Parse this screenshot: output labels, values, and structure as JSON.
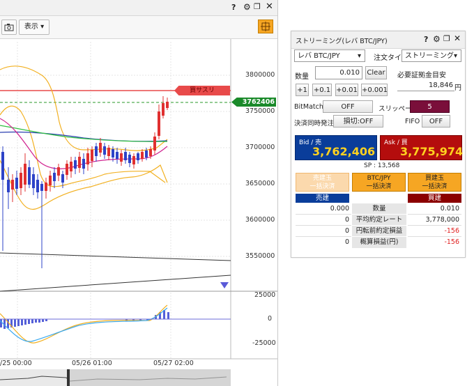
{
  "chart_window": {
    "toolbar": {
      "display_label": "表示 ▾"
    },
    "price_axis": [
      "3800000",
      "3750000",
      "3700000",
      "3650000",
      "3600000",
      "3550000"
    ],
    "current_price_tag": "3762406",
    "order_line_label": "買サスリ",
    "oscillator_axis": [
      "25000",
      "0",
      "-25000"
    ],
    "time_axis": [
      "/25 00:00",
      "05/26 01:00",
      "05/27 02:00"
    ]
  },
  "panel": {
    "title": "ストリーミング(レバ BTC/JPY)",
    "symbol": "レバ BTC/JPY",
    "order_type_label": "注文タイプ",
    "order_type_value": "ストリーミング",
    "quantity_label": "数量",
    "quantity_value": "0.010",
    "clear_label": "Clear",
    "margin_label": "必要証拠金目安",
    "margin_value": "18,846",
    "margin_unit": "円",
    "increments": [
      "+1",
      "+0.1",
      "+0.01",
      "+0.001"
    ],
    "bitmatch_label": "BitMatch",
    "bitmatch_value": "OFF",
    "slippage_label": "スリッページ",
    "slippage_value": "5",
    "settle_label": "決済同時発注",
    "settle_value": "損切:OFF",
    "fifo_label": "FIFO",
    "fifo_value": "OFF",
    "bid_label": "Bid / 売",
    "bid_value": "3,762,406",
    "ask_label": "Ask / 買",
    "ask_value": "3,775,974",
    "spread": "SP : 13,568",
    "bulk_sell": [
      "売建玉",
      "一括決済"
    ],
    "bulk_all": [
      "BTC/JPY",
      "一括決済"
    ],
    "bulk_buy": [
      "買建玉",
      "一括決済"
    ],
    "sell_header": "売建",
    "buy_header": "買建",
    "rows": [
      {
        "label": "数量",
        "sell": "0.000",
        "buy": "0.010"
      },
      {
        "label": "平均約定レート",
        "sell": "0",
        "buy": "3,778,000"
      },
      {
        "label": "円転前約定損益",
        "sell": "0",
        "buy": "-156"
      },
      {
        "label": "概算損益(円)",
        "sell": "0",
        "buy": "-156"
      }
    ]
  },
  "colors": {
    "bid_bg": "#0a3d9a",
    "ask_bg": "#b40d0d",
    "accent_orange": "#f6a623",
    "up_candle": "#2d43c8",
    "down_candle": "#e03030",
    "tag_green": "#1a8a2a"
  }
}
